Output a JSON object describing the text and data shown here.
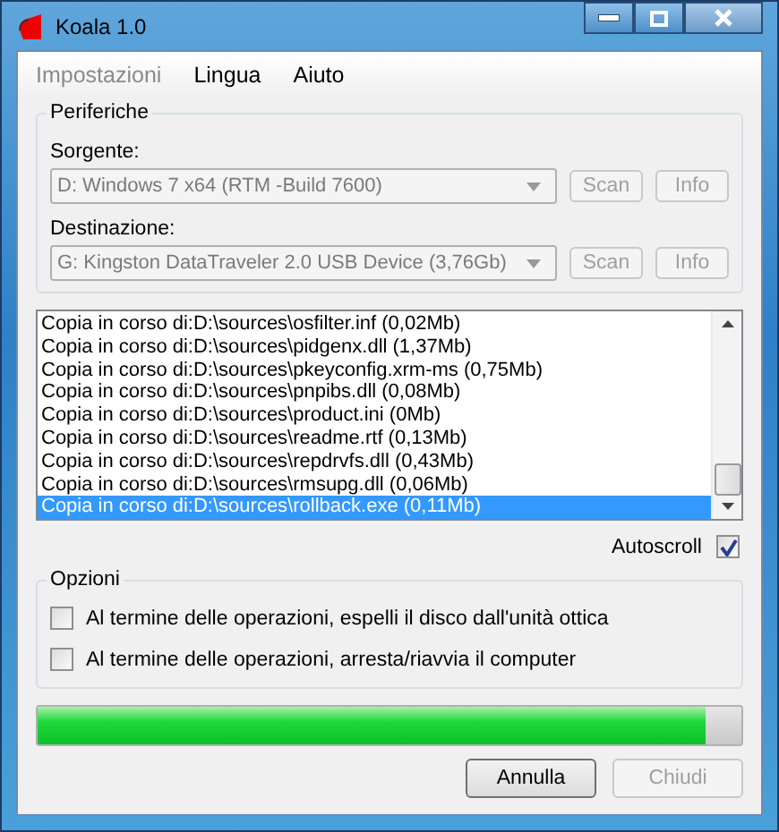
{
  "window": {
    "title": "Koala 1.0"
  },
  "menu": [
    {
      "label": "Impostazioni",
      "disabled": true
    },
    {
      "label": "Lingua",
      "disabled": false
    },
    {
      "label": "Aiuto",
      "disabled": false
    }
  ],
  "devices": {
    "title": "Periferiche",
    "source": {
      "label": "Sorgente:",
      "value": "D: Windows 7 x64 (RTM -Build 7600)",
      "disabled": true,
      "buttons": [
        {
          "label": "Scan",
          "disabled": true
        },
        {
          "label": "Info",
          "disabled": true
        }
      ]
    },
    "destination": {
      "label": "Destinazione:",
      "value": "G: Kingston DataTraveler 2.0 USB Device (3,76Gb)",
      "disabled": true,
      "buttons": [
        {
          "label": "Scan",
          "disabled": true
        },
        {
          "label": "Info",
          "disabled": true
        }
      ]
    }
  },
  "log": [
    {
      "text": "Copia in corso di:D:\\sources\\osfilter.inf (0,02Mb)",
      "selected": false
    },
    {
      "text": "Copia in corso di:D:\\sources\\pidgenx.dll (1,37Mb)",
      "selected": false
    },
    {
      "text": "Copia in corso di:D:\\sources\\pkeyconfig.xrm-ms (0,75Mb)",
      "selected": false
    },
    {
      "text": "Copia in corso di:D:\\sources\\pnpibs.dll (0,08Mb)",
      "selected": false
    },
    {
      "text": "Copia in corso di:D:\\sources\\product.ini (0Mb)",
      "selected": false
    },
    {
      "text": "Copia in corso di:D:\\sources\\readme.rtf (0,13Mb)",
      "selected": false
    },
    {
      "text": "Copia in corso di:D:\\sources\\repdrvfs.dll (0,43Mb)",
      "selected": false
    },
    {
      "text": "Copia in corso di:D:\\sources\\rmsupg.dll (0,06Mb)",
      "selected": false
    },
    {
      "text": "Copia in corso di:D:\\sources\\rollback.exe (0,11Mb)",
      "selected": true
    }
  ],
  "autoscroll": {
    "label": "Autoscroll",
    "checked": true
  },
  "options": {
    "title": "Opzioni",
    "items": [
      {
        "label": "Al termine delle operazioni, espelli il disco dall'unità ottica",
        "checked": false
      },
      {
        "label": "Al termine delle operazioni, arresta/riavvia il computer",
        "checked": false
      }
    ]
  },
  "progress": {
    "level": 0.95
  },
  "buttons": [
    {
      "label": "Annulla",
      "disabled": false
    },
    {
      "label": "Chiudi",
      "disabled": true
    }
  ]
}
